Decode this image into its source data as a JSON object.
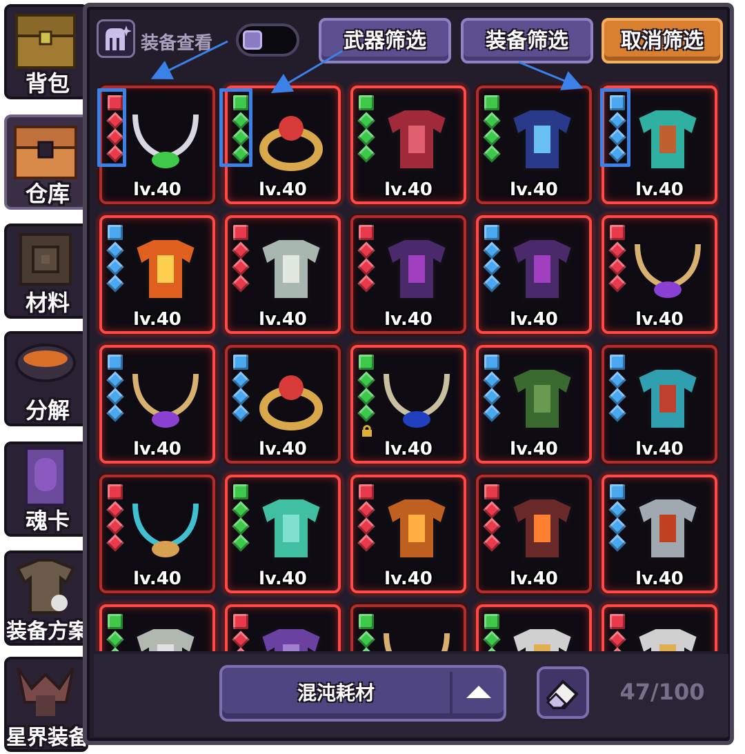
{
  "sidebar": {
    "tabs": [
      {
        "label": "背包",
        "icon": "chest-icon"
      },
      {
        "label": "仓库",
        "icon": "warehouse-chest-icon",
        "active": true
      },
      {
        "label": "材料",
        "icon": "materials-icon"
      },
      {
        "label": "分解",
        "icon": "decompose-pot-icon"
      },
      {
        "label": "魂卡",
        "icon": "soul-card-icon"
      },
      {
        "label": "装备方案",
        "icon": "equipment-plan-icon"
      },
      {
        "label": "星界装备",
        "icon": "astral-equipment-icon"
      }
    ]
  },
  "topbar": {
    "view_label": "装备查看",
    "weapon_filter": "武器筛选",
    "equipment_filter": "装备筛选",
    "cancel_filter": "取消筛选"
  },
  "grid": {
    "rows": [
      [
        {
          "level": "lv.40",
          "gem": "red",
          "art": "circlet"
        },
        {
          "level": "lv.40",
          "gem": "green",
          "art": "ring"
        },
        {
          "level": "lv.40",
          "gem": "green",
          "art": "armor-red"
        },
        {
          "level": "lv.40",
          "gem": "green",
          "art": "hat"
        },
        {
          "level": "lv.40",
          "gem": "blue",
          "art": "cloak-winged"
        }
      ],
      [
        {
          "level": "lv.40",
          "gem": "blue",
          "art": "flame-crown"
        },
        {
          "level": "lv.40",
          "gem": "red",
          "art": "boot"
        },
        {
          "level": "lv.40",
          "gem": "red",
          "art": "armor-purple"
        },
        {
          "level": "lv.40",
          "gem": "blue",
          "art": "armor-purple"
        },
        {
          "level": "lv.40",
          "gem": "red",
          "art": "necklace-purple"
        }
      ],
      [
        {
          "level": "lv.40",
          "gem": "blue",
          "art": "necklace-purple"
        },
        {
          "level": "lv.40",
          "gem": "blue",
          "art": "ring"
        },
        {
          "level": "lv.40",
          "gem": "green",
          "art": "necklace-blue",
          "locked": true
        },
        {
          "level": "lv.40",
          "gem": "blue",
          "art": "robe-green"
        },
        {
          "level": "lv.40",
          "gem": "blue",
          "art": "cape-feather"
        }
      ],
      [
        {
          "level": "lv.40",
          "gem": "red",
          "art": "necklace-teal"
        },
        {
          "level": "lv.40",
          "gem": "green",
          "art": "boot-teal"
        },
        {
          "level": "lv.40",
          "gem": "red",
          "art": "armor-flame"
        },
        {
          "level": "lv.40",
          "gem": "red",
          "art": "robe-flame"
        },
        {
          "level": "lv.40",
          "gem": "blue",
          "art": "helmet-eagle"
        }
      ],
      [
        {
          "level": "",
          "gem": "green",
          "art": "crown-silver"
        },
        {
          "level": "",
          "gem": "red",
          "art": "orb"
        },
        {
          "level": "",
          "gem": "green",
          "art": "necklace-gold"
        },
        {
          "level": "",
          "gem": "green",
          "art": "helm-silver"
        },
        {
          "level": "",
          "gem": "red",
          "art": "helm-silver"
        }
      ]
    ]
  },
  "bottombar": {
    "category": "混沌耗材",
    "capacity": "47/100"
  },
  "colors": {
    "gem_red": "#e83a4a",
    "gem_green": "#3ec94a",
    "gem_blue": "#4aa8f0",
    "cell_border": "#ff4a4a",
    "highlight": "#3b82e8"
  }
}
